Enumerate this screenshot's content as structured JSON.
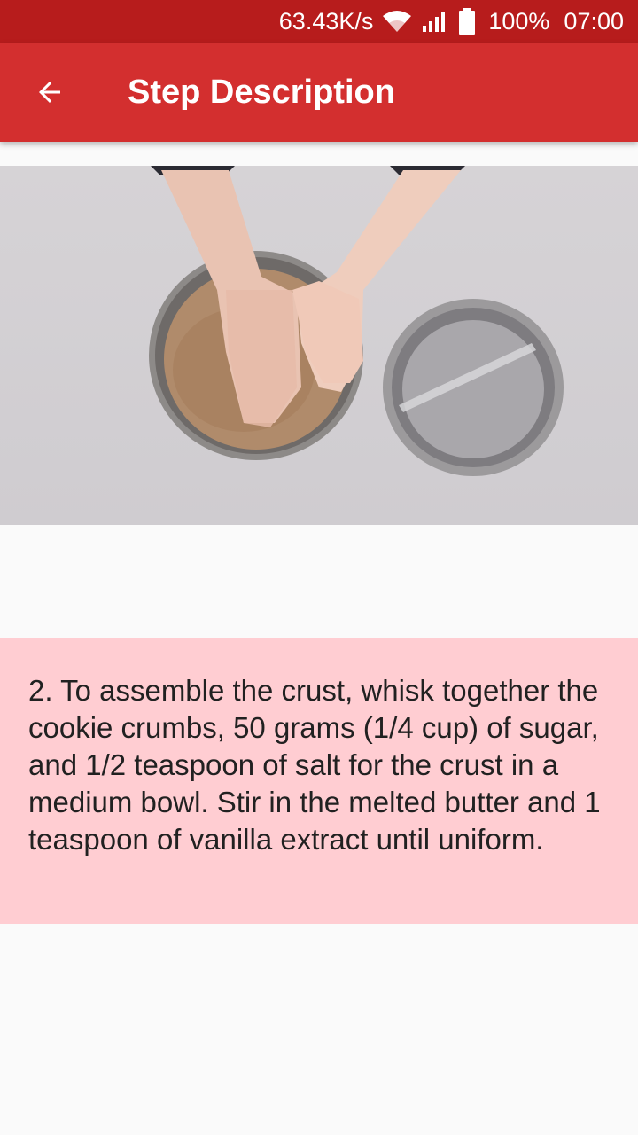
{
  "status_bar": {
    "network_speed": "63.43K/s",
    "battery_percent": "100%",
    "time": "07:00",
    "icons": [
      "wifi-icon",
      "signal-icon",
      "battery-icon"
    ]
  },
  "app_bar": {
    "title": "Step Description",
    "back_icon": "arrow-back-icon"
  },
  "video": {
    "content": "video-frame"
  },
  "step": {
    "description": "2. To assemble the crust, whisk together the cookie crumbs, 50 grams (1/4 cup) of sugar, and 1/2 teaspoon of salt for the crust in a medium bowl. Stir in the melted butter and 1 teaspoon of vanilla extract until uniform."
  },
  "colors": {
    "status_bar": "#b71c1c",
    "app_bar": "#d32f2f",
    "description_background": "#ffcdd2",
    "page_background": "#fafafa"
  }
}
